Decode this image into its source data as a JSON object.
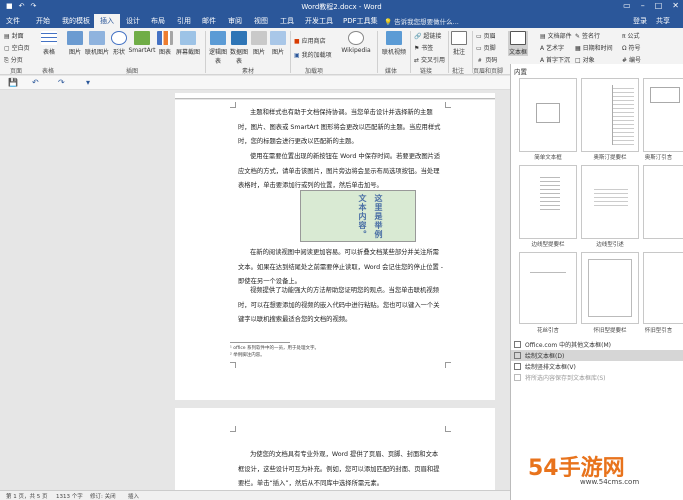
{
  "window": {
    "title": "Word教程2.docx - Word"
  },
  "tabs": [
    "文件",
    "开始",
    "我的模板",
    "插入",
    "设计",
    "布局",
    "引用",
    "邮件",
    "审阅",
    "视图",
    "工具",
    "开发工具",
    "PDF工具集"
  ],
  "active_tab": "插入",
  "tellme": "告诉我您想要做什么...",
  "account": {
    "login": "登录",
    "share": "共享"
  },
  "ribbon": {
    "pages": {
      "cover": "封面",
      "blank": "空白页",
      "break": "分页",
      "label": "页面"
    },
    "table": {
      "label": "表格"
    },
    "illustrations": {
      "pictures": "图片",
      "online": "联机图片",
      "shapes": "形状",
      "smartart": "SmartArt",
      "chart": "图表",
      "screenshot": "屏幕截图",
      "label": "插图"
    },
    "addins": {
      "logic": "逻辑图表",
      "data": "数据图表",
      "image": "图片",
      "pic": "图片",
      "label": "素材"
    },
    "store": {
      "app": "应用商店",
      "my": "我的加载项",
      "label": "加载项"
    },
    "media": {
      "wikipedia": "Wikipedia",
      "video": "联机视频",
      "label": "媒体"
    },
    "links": {
      "hyperlink": "超链接",
      "bookmark": "书签",
      "crossref": "交叉引用",
      "label": "链接"
    },
    "comments": {
      "comment": "批注",
      "label": "批注"
    },
    "header": {
      "header": "页眉",
      "footer": "页脚",
      "pagenum": "页码",
      "label": "页眉和页脚"
    },
    "text": {
      "textbox": "文本框",
      "parts": "文档部件",
      "wordart": "艺术字",
      "dropcap": "首字下沉",
      "sig": "签名行",
      "date": "日期和时间",
      "obj": "对象"
    },
    "symbols": {
      "formula": "公式",
      "symbol": "符号",
      "number": "编号"
    }
  },
  "gallery": {
    "header": "内置",
    "items": [
      "简单文本框",
      "奥斯汀提要栏",
      "奥斯汀引言",
      "边线型提要栏",
      "边线型引述",
      "",
      "花丝引言",
      "怀旧型提要栏",
      "怀旧型引言"
    ],
    "menu": [
      "Office.com 中的其他文本框(M)",
      "绘制文本框(D)",
      "绘制竖排文本框(V)",
      "将所选内容保存到文本框库(S)"
    ]
  },
  "document": {
    "p1": "主题和样式也有助于文档保持协调。当您单击设计并选择新的主题时，图片、图表或 SmartArt 图形将会更改以匹配新的主题。当应用样式时，您的标题会进行更改以匹配新的主题。",
    "p2": "使用在需要位置出现的新按钮在 Word 中保存时间。若要更改图片适应文档的方式，请单击该图片，图片旁边将会显示布局选项按钮。当处理表格时，单击要添加行或列的位置，然后单击加号。",
    "textbox": {
      "col1": "这里是举例",
      "col2": "文本内容。"
    },
    "p3": "在新的阅读视图中阅读更加容易。可以折叠文档某些部分并关注所需文本。如果在达到结尾处之前需要停止读取，Word 会记住您的停止位置 - 即使在另一个设备上。",
    "p4": "视频提供了功能强大的方法帮助您证明您的观点。当您单击联机视频时，可以在想要添加的视频的嵌入代码中进行粘贴。您也可以键入一个关键字以联机搜索最适合您的文档的视频。",
    "footnote1": "¹ office 系列软件中的一员，用于处理文字。",
    "footnote2": "² 举例脚注内容。",
    "p5": "为使您的文档具有专业外观，Word 提供了页眉、页脚、封面和文本框设计，这些设计可互为补充。例如，您可以添加匹配的封面、页眉和提要栏。单击“插入”，然后从不同库中选择所需元素。"
  },
  "status": {
    "page": "第 1 页，共 5 页",
    "words": "1313 个字",
    "track": "修订: 关闭",
    "mode": "插入"
  },
  "watermark": {
    "brand": "54手游网",
    "url": "www.54cms.com"
  }
}
